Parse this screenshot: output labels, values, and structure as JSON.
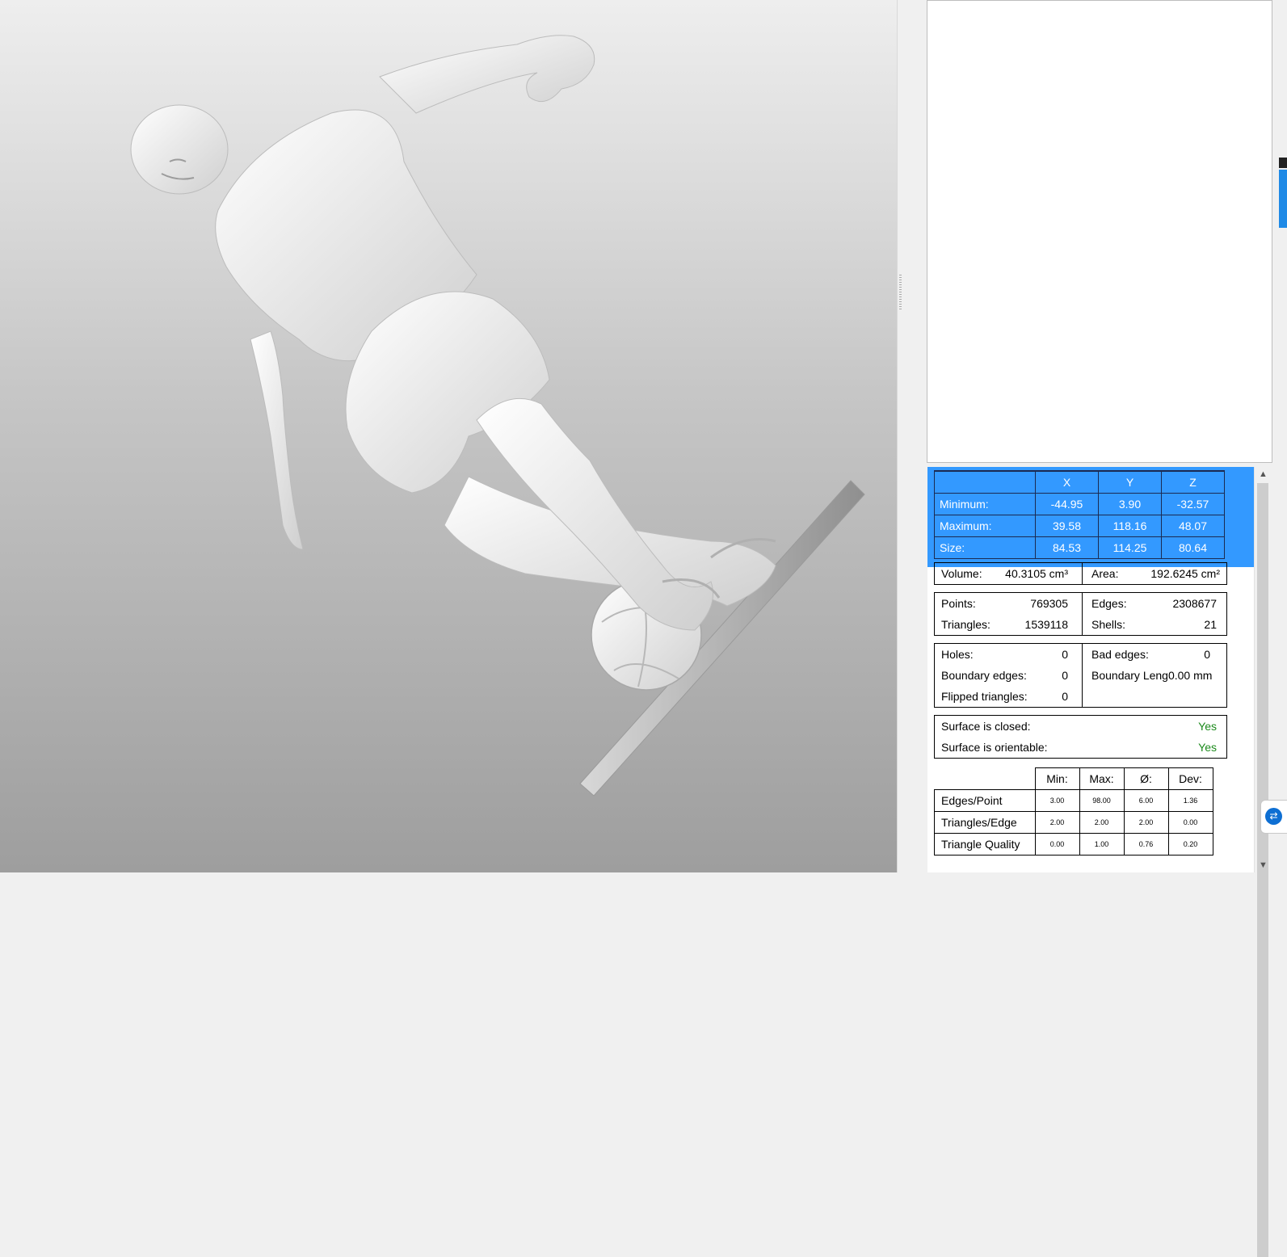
{
  "coords": {
    "headers": [
      "X",
      "Y",
      "Z"
    ],
    "rows": [
      {
        "label": "Minimum:",
        "x": "-44.95",
        "y": "3.90",
        "z": "-32.57"
      },
      {
        "label": "Maximum:",
        "x": "39.58",
        "y": "118.16",
        "z": "48.07"
      },
      {
        "label": "Size:",
        "x": "84.53",
        "y": "114.25",
        "z": "80.64"
      }
    ]
  },
  "volume": {
    "label": "Volume:",
    "value": "40.3105 cm³",
    "area_label": "Area:",
    "area_value": "192.6245 cm²"
  },
  "counts": {
    "points_label": "Points:",
    "points": "769305",
    "edges_label": "Edges:",
    "edges": "2308677",
    "triangles_label": "Triangles:",
    "triangles": "1539118",
    "shells_label": "Shells:",
    "shells": "21"
  },
  "errors": {
    "holes_label": "Holes:",
    "holes": "0",
    "bad_edges_label": "Bad edges:",
    "bad_edges": "0",
    "boundary_edges_label": "Boundary edges:",
    "boundary_edges": "0",
    "boundary_length_label": "Boundary Leng0.00 mm",
    "flipped_label": "Flipped triangles:",
    "flipped": "0"
  },
  "surface": {
    "closed_label": "Surface is closed:",
    "closed": "Yes",
    "orientable_label": "Surface is orientable:",
    "orientable": "Yes"
  },
  "stats": {
    "headers": [
      "Min:",
      "Max:",
      "Ø:",
      "Dev:"
    ],
    "rows": [
      {
        "label": "Edges/Point",
        "min": "3.00",
        "max": "98.00",
        "avg": "6.00",
        "dev": "1.36"
      },
      {
        "label": "Triangles/Edge",
        "min": "2.00",
        "max": "2.00",
        "avg": "2.00",
        "dev": "0.00"
      },
      {
        "label": "Triangle Quality",
        "min": "0.00",
        "max": "1.00",
        "avg": "0.76",
        "dev": "0.20"
      }
    ]
  },
  "colors": {
    "selection": "#3399ff",
    "ok_green": "#1c8a1c"
  },
  "icons": {
    "teamviewer": "teamviewer-icon",
    "scroll_up": "scroll-up-icon",
    "scroll_down": "scroll-down-icon"
  }
}
